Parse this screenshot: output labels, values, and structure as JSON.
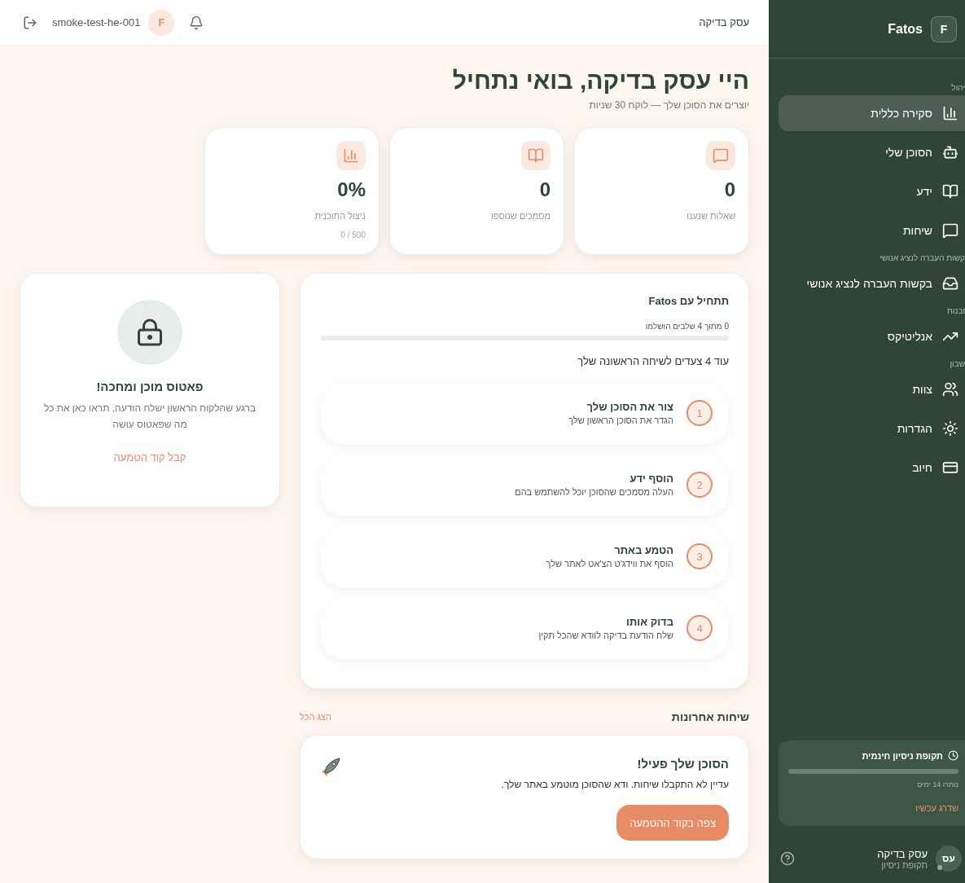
{
  "sidebar": {
    "brand": {
      "logo_letter": "F",
      "name": "Fatos"
    },
    "sections": [
      {
        "label": "יהול",
        "items": [
          {
            "kind": "overview",
            "label": "סקירה כללית",
            "selected": true
          },
          {
            "kind": "agent",
            "label": "הסוכן שלי",
            "selected": false
          },
          {
            "kind": "knowledge",
            "label": "ידע",
            "selected": false
          },
          {
            "kind": "conversations",
            "label": "שיחות",
            "selected": false
          }
        ]
      },
      {
        "label": "קשות העברה לנציג אנושי",
        "items": [
          {
            "kind": "handoff",
            "label": "בקשות העברה לנציג אנושי",
            "selected": false
          }
        ]
      },
      {
        "label": "ובנות",
        "items": [
          {
            "kind": "analytics",
            "label": "אנליטיקס",
            "selected": false
          }
        ]
      },
      {
        "label": "שבון",
        "items": [
          {
            "kind": "team",
            "label": "צוות",
            "selected": false
          },
          {
            "kind": "settings",
            "label": "הגדרות",
            "selected": false
          },
          {
            "kind": "billing",
            "label": "חיוב",
            "selected": false
          }
        ]
      }
    ],
    "trial": {
      "title": "תקופת ניסיון חינמית",
      "level": 0,
      "remaining": "נותרו 14 ימים",
      "link": "שדרג עכשיו"
    },
    "user": {
      "initials": "עס",
      "name": "עסק בדיקה",
      "plan": "תקופת ניסיון"
    }
  },
  "header": {
    "business": "עסק בדיקה",
    "avatar_letter": "F",
    "account": "smoke-test-he-001"
  },
  "page": {
    "title": "היי עסק בדיקה, בואי נתחיל",
    "subtitle": "יוצרים את הסוכן שלך — לוקח 30 שניות"
  },
  "stats": [
    {
      "kind": "conversations",
      "value": "0",
      "label": "שאלות שנענו"
    },
    {
      "kind": "knowledge",
      "value": "0",
      "label": "מסמכים שנוספו"
    },
    {
      "kind": "overview",
      "value": "0%",
      "label": "ניצול התוכנית",
      "note": "500 / 0"
    }
  ],
  "onboarding": {
    "title": "תתחיל עם Fatos",
    "progress_text": "0 מתוך 4 שלבים הושלמו",
    "level": 0,
    "remaining": "עוד 4 צעדים לשיחה הראשונה שלך",
    "steps": [
      {
        "number": "1",
        "title": "צור את הסוכן שלך",
        "description": "הגדר את הסוכן הראשון שלך"
      },
      {
        "number": "2",
        "title": "הוסף ידע",
        "description": "העלה מסמכים שהסוכן יוכל להשתמש בהם"
      },
      {
        "number": "3",
        "title": "הטמע באתר",
        "description": "הוסף את ווידג'ט הצ'אט לאתר שלך"
      },
      {
        "number": "4",
        "title": "בדוק אותו",
        "description": "שלח הודעת בדיקה לוודא שהכל תקין"
      }
    ]
  },
  "locked": {
    "title": "פאטוס מוכן ומחכה!",
    "text": "ברגע שהלקוח הראשון ישלח הודעה, תראו כאן את כל מה שפאטוס עושה",
    "link": "קבל קוד הטמעה"
  },
  "recent": {
    "title": "שיחות אחרונות",
    "view_all": "הצג הכל",
    "empty_title": "הסוכן שלך פעיל!",
    "empty_text": "עדיין לא התקבלו שיחות. ודא שהסוכן מוטמע באתר שלך.",
    "button": "צפה בקוד ההטמעה"
  }
}
